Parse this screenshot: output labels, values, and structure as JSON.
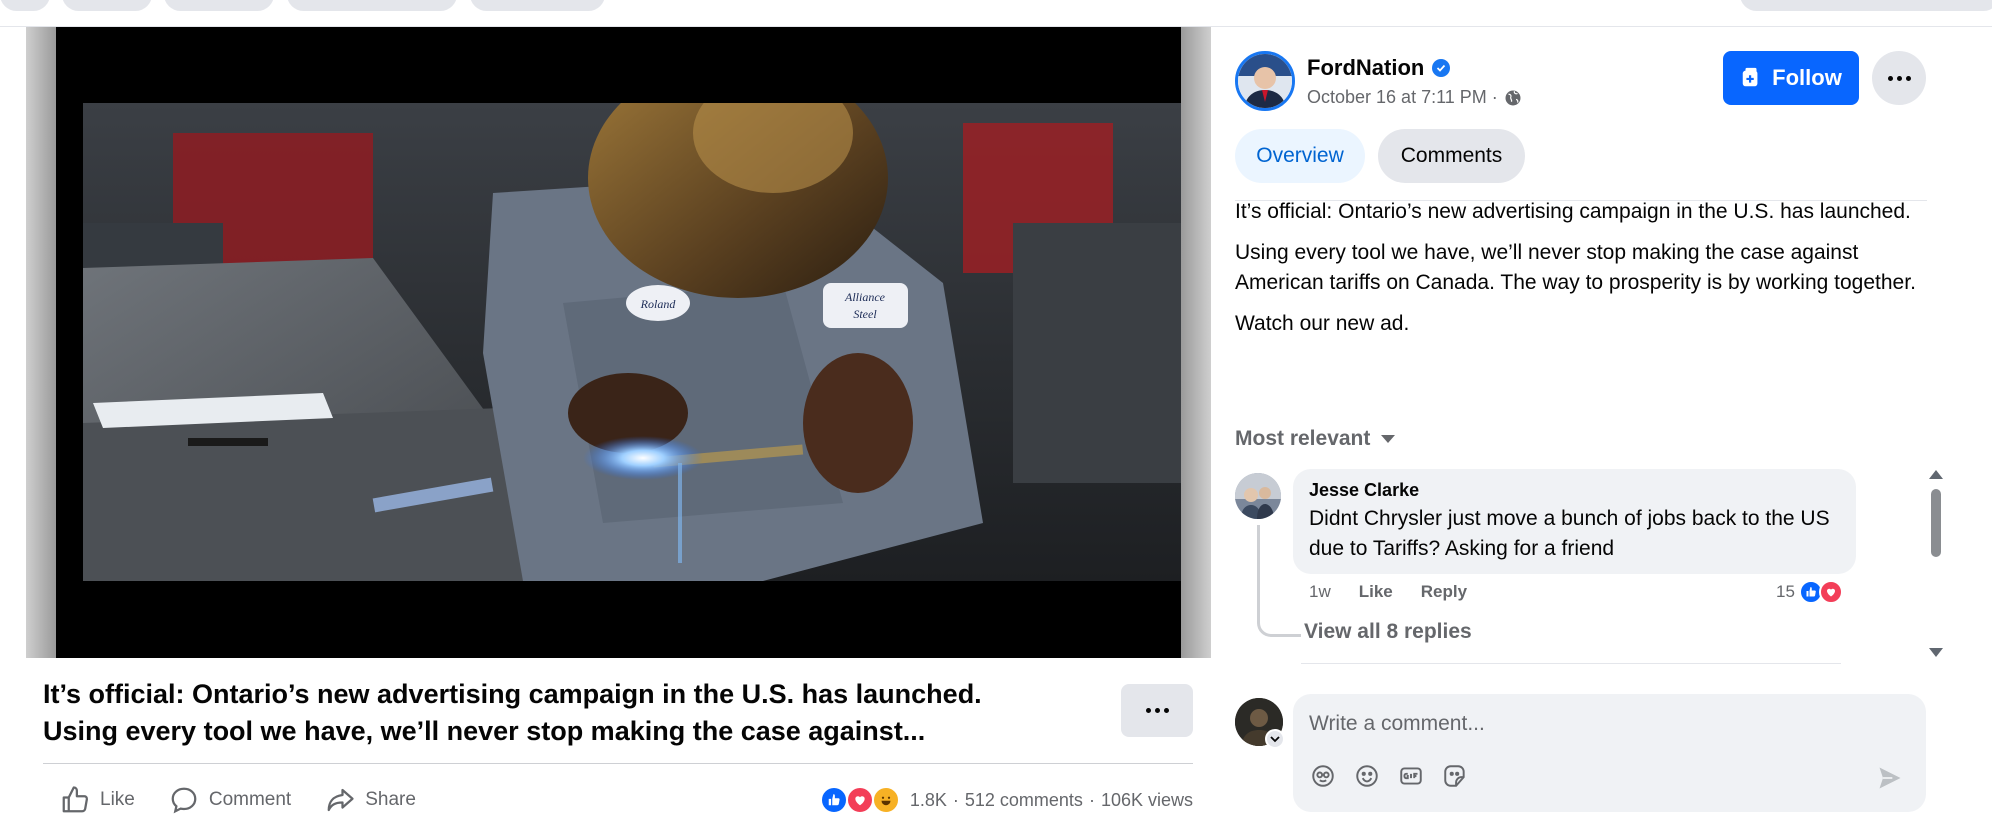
{
  "post": {
    "title_line1": "It’s official: Ontario’s new advertising campaign in the U.S. has launched.",
    "title_line2": "Using every tool we have, we’ll never stop making the case against...",
    "actions": {
      "like": "Like",
      "comment": "Comment",
      "share": "Share"
    },
    "stats": {
      "reactions": "1.8K",
      "sep1": "·",
      "comments": "512 comments",
      "sep2": "·",
      "views": "106K views"
    },
    "video": {
      "patch_left": "Roland",
      "patch_right_line1": "Alliance",
      "patch_right_line2": "Steel"
    }
  },
  "panel": {
    "author": "FordNation",
    "date": "October 16 at 7:11 PM ·",
    "follow_label": "Follow",
    "tabs": [
      "Overview",
      "Comments"
    ],
    "description": [
      "It’s official: Ontario’s new advertising campaign in the U.S. has launched.",
      "Using every tool we have, we’ll never stop making the case against American tariffs on Canada. The way to prosperity is by working together.",
      "Watch our new ad."
    ],
    "sort_label": "Most relevant"
  },
  "comment": {
    "name": "Jesse Clarke",
    "text": "Didnt Chrysler just move a bunch of jobs back to the US due to Tariffs? Asking for a friend",
    "time": "1w",
    "like": "Like",
    "reply": "Reply",
    "reaction_count": "15",
    "view_replies": "View all 8 replies"
  },
  "composer": {
    "placeholder": "Write a comment..."
  },
  "colors": {
    "accent": "#0866ff",
    "tab_active_bg": "#ebf5ff",
    "tab_active_text": "#0064d1",
    "love": "#f33e58",
    "haha": "#f7b125"
  }
}
